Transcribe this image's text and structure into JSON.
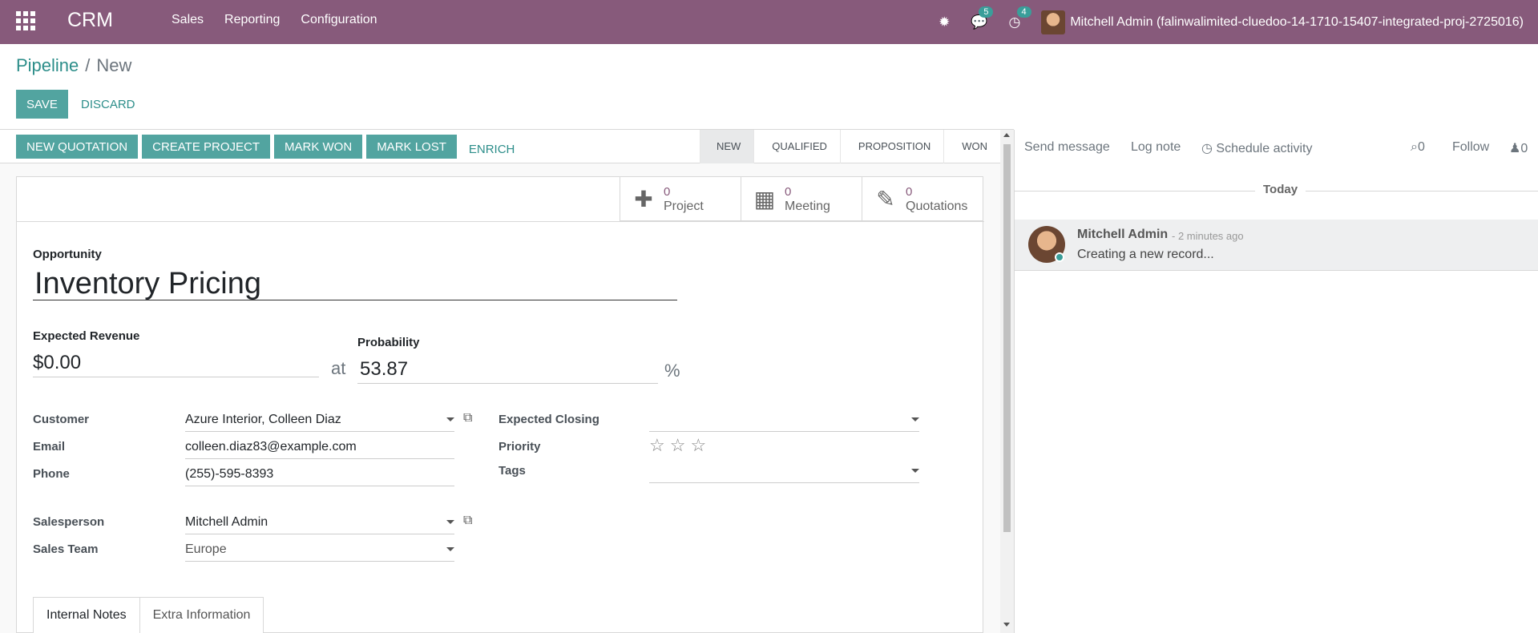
{
  "navbar": {
    "app_name": "CRM",
    "menu": [
      "Sales",
      "Reporting",
      "Configuration"
    ],
    "messages_count": "5",
    "activities_count": "4",
    "user": "Mitchell Admin (falinwalimited-cluedoo-14-1710-15407-integrated-proj-2725016)"
  },
  "breadcrumb": {
    "parent": "Pipeline",
    "current": "New"
  },
  "control": {
    "save": "SAVE",
    "discard": "DISCARD"
  },
  "statusbar": {
    "buttons": [
      "NEW QUOTATION",
      "CREATE PROJECT",
      "MARK WON",
      "MARK LOST"
    ],
    "enrich": "ENRICH",
    "stages": [
      "NEW",
      "QUALIFIED",
      "PROPOSITION",
      "WON"
    ],
    "active_stage": "NEW"
  },
  "smart_buttons": [
    {
      "value": "0",
      "label": "Project",
      "icon": "puzzle-icon"
    },
    {
      "value": "0",
      "label": "Meeting",
      "icon": "calendar-icon"
    },
    {
      "value": "0",
      "label": "Quotations",
      "icon": "pencil-square-icon"
    }
  ],
  "form": {
    "opportunity_label": "Opportunity",
    "opportunity_name": "Inventory Pricing",
    "revenue_label": "Expected Revenue",
    "revenue_value": "$0.00",
    "at": "at",
    "probability_label": "Probability",
    "probability_value": "53.87",
    "percent": "%",
    "customer_label": "Customer",
    "customer_value": "Azure Interior, Colleen Diaz",
    "email_label": "Email",
    "email_value": "colleen.diaz83@example.com",
    "phone_label": "Phone",
    "phone_value": "(255)-595-8393",
    "salesperson_label": "Salesperson",
    "salesperson_value": "Mitchell Admin",
    "team_label": "Sales Team",
    "team_value": "Europe",
    "closing_label": "Expected Closing",
    "closing_value": "",
    "priority_label": "Priority",
    "tags_label": "Tags",
    "tags_value": ""
  },
  "tabs": [
    "Internal Notes",
    "Extra Information"
  ],
  "chatter": {
    "send_message": "Send message",
    "log_note": "Log note",
    "schedule_activity": "Schedule activity",
    "attachments_count": "0",
    "follow": "Follow",
    "followers_count": "0",
    "today": "Today",
    "message": {
      "author": "Mitchell Admin",
      "date": "- 2 minutes ago",
      "body": "Creating a new record..."
    }
  }
}
